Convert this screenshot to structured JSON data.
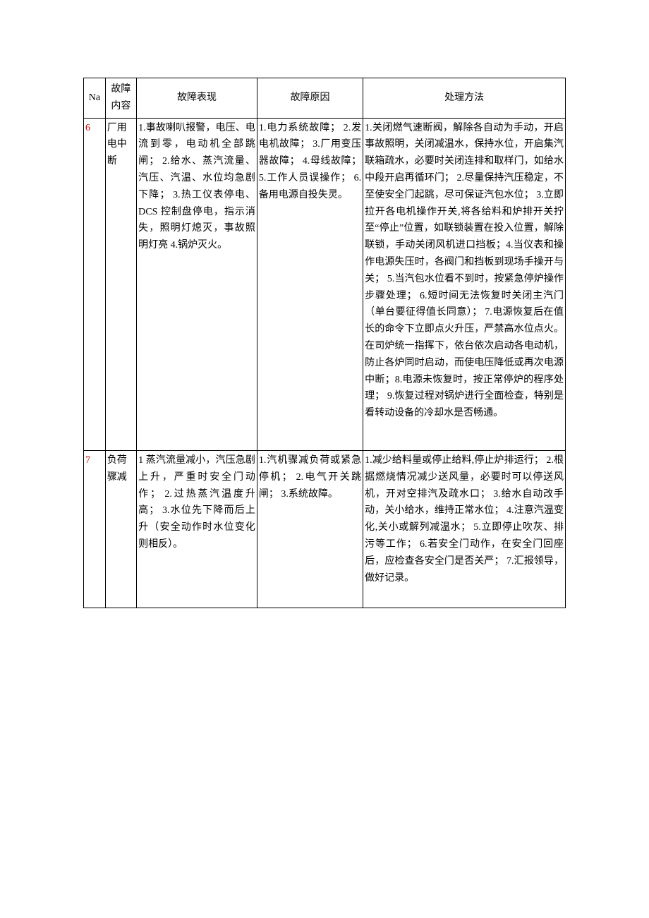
{
  "headers": {
    "na": "Na",
    "content": "故障内容",
    "manifestation": "故障表现",
    "cause": "故障原因",
    "method": "处理方法"
  },
  "rows": [
    {
      "na": "6",
      "content": "厂用电中断",
      "manifestation": "1.事故喇叭报警，电压、电流到零，电动机全部跳闸；\n2.给水、蒸汽流量、汽压、汽温、水位均急剧下降；\n3.热工仪表停电、DCS 控制盘停电，指示消失，照明灯熄灭，事故照明灯亮\n4.锅炉灭火。",
      "cause": "1.电力系统故障；\n2.发电机故障；\n3.厂用变压器故障；\n4.母线故障；\n5.工作人员误操作；\n6.备用电源自投失灵。",
      "method": "1.关闭燃气速断阀，解除各自动为手动，开启事故照明，关闭减温水，保持水位，开启集汽联箱疏水，必要时关闭连排和取样门，如给水中段开启再循环门；\n2.尽量保持汽压稳定，不至使安全门起跳，尽可保证汽包水位；\n3.立即拉开各电机操作开关,将各给料和炉排开关拧至“停止”位置，如联锁装置在投入位置，解除联锁，手动关闭风机进口挡板；4.当仪表和操作电源失压时，各阀门和挡板到现场手操开与关；\n5.当汽包水位看不到时，按紧急停炉操作步骤处理；\n6.短时间无法恢复时关闭主汽门（单台要征得值长同意）；\n7.电源恢复后在值长的命令下立即点火升压，严禁高水位点火。在司炉统一指挥下，依台依次启动各电动机，防止各炉同时启动，而使电压降低或再次电源中断；8.电源未恢复时，按正常停炉的程序处理；\n9.恢复过程对锅炉进行全面检查，特别是看转动设备的冷却水是否畅通。"
    },
    {
      "na": "7",
      "content": "负荷骤减",
      "manifestation": "1 蒸汽流量减小，汽压急剧上升，严重时安全门动作；\n2.过热蒸汽温度升高；\n3.水位先下降而后上升（安全动作时水位变化则相反）。",
      "cause": "1.汽机骤减负荷或紧急停机；\n2.电气开关跳闸；\n3.系统故障。",
      "method": "1.减少给料量或停止给料,停止炉排运行；\n2.根据燃烧情况减少送风量，必要时可以停送风机，开对空排汽及疏水口；\n3.给水自动改手动，关小给水，维持正常水位；\n4.注意汽温变化,关小或解列减温水；\n5.立即停止吹灰、排污等工作；\n6.若安全门动作，在安全门回座后，应检查各安全门是否关严；\n7.汇报领导，做好记录。"
    }
  ]
}
